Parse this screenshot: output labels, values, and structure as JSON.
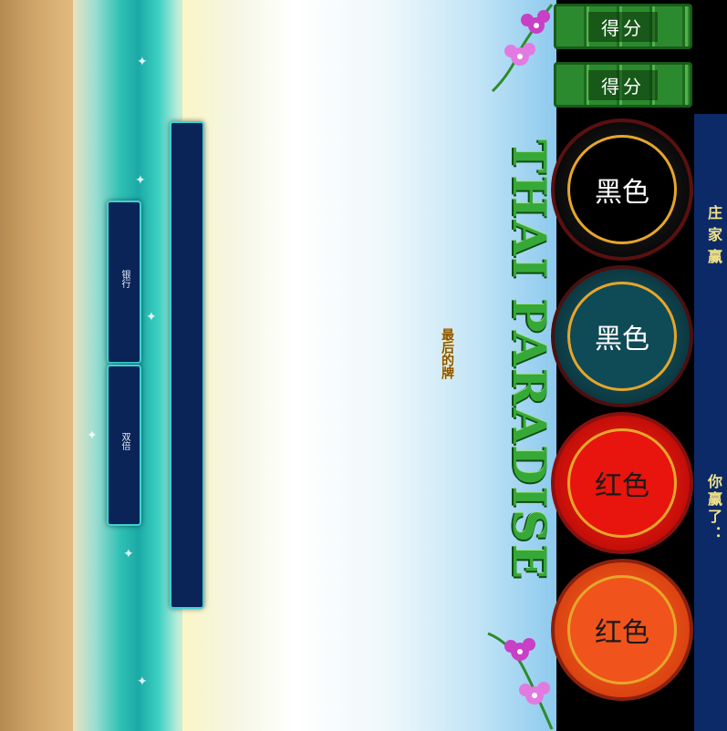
{
  "title": "THAI PARADISE",
  "last_card_label": "最后的牌",
  "left_panels": {
    "bank_label": "银行",
    "double_label": "双倍"
  },
  "score_buttons": [
    {
      "label": "得分"
    },
    {
      "label": "得分"
    }
  ],
  "bet_chips": [
    {
      "label": "黑色",
      "color": "#111111",
      "ring": "#e6a62a"
    },
    {
      "label": "黑色",
      "color": "#0f4a57",
      "ring": "#e6a62a"
    },
    {
      "label": "红色",
      "color": "#e8140e",
      "ring": "#e6a62a"
    },
    {
      "label": "红色",
      "color": "#f0531b",
      "ring": "#e6a62a"
    }
  ],
  "status": {
    "banker_wins": "庄家赢",
    "you_won": "你赢了："
  },
  "colors": {
    "panel_bg": "#0b2457",
    "panel_border": "#3bd3d6",
    "side_bar": "#0c2a68",
    "side_text": "#f2e38a"
  }
}
